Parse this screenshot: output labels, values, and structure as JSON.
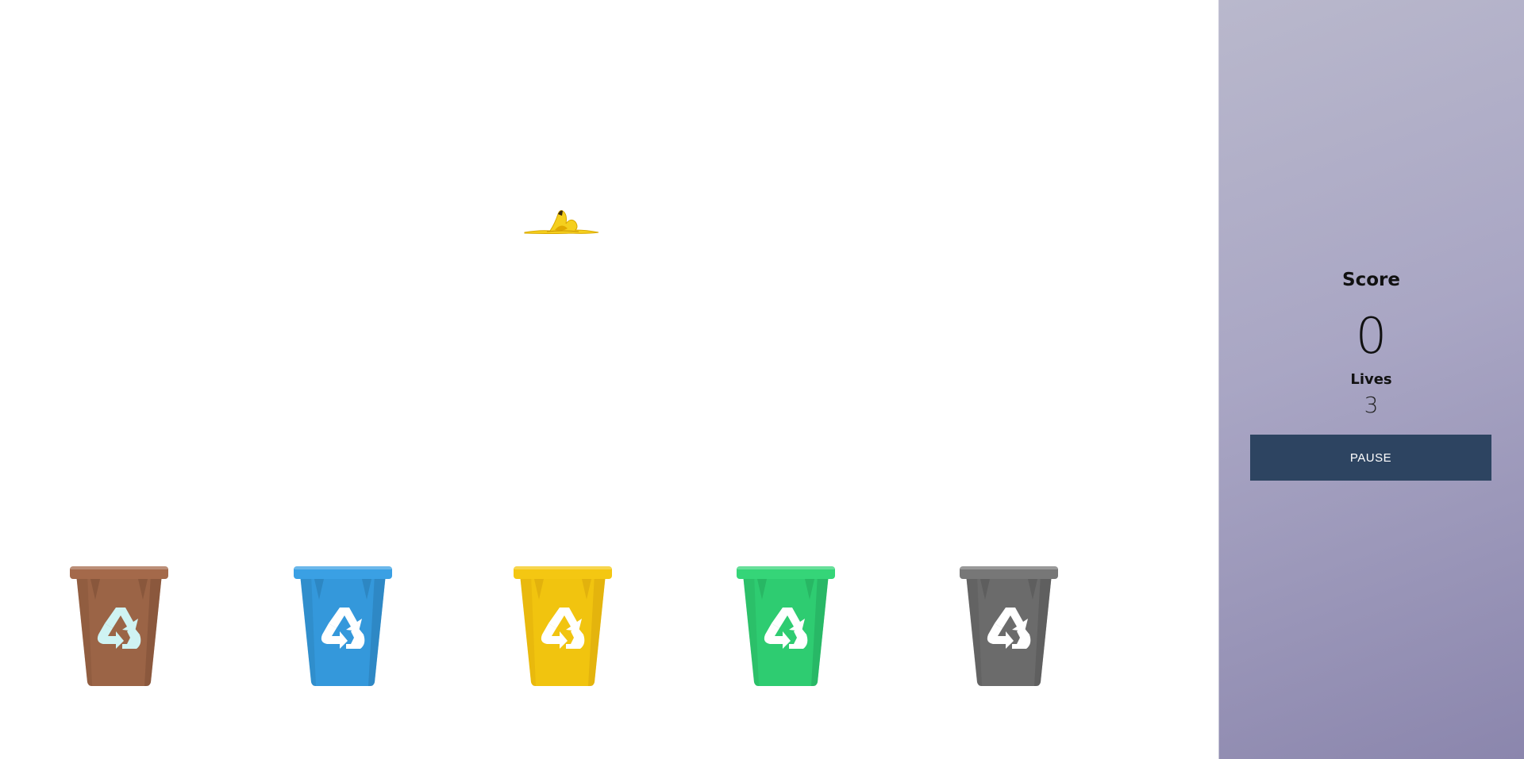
{
  "game": {
    "falling_item": {
      "name": "banana peel",
      "icon": "banana-peel-icon"
    },
    "bins": [
      {
        "name": "brown-bin",
        "color": "#9b6446",
        "dark": "#7d4f36",
        "lip": "#a4694a",
        "symbol": "#cff3f3"
      },
      {
        "name": "blue-bin",
        "color": "#3498db",
        "dark": "#2a7bb3",
        "lip": "#3aa0e4",
        "symbol": "#ffffff"
      },
      {
        "name": "yellow-bin",
        "color": "#f1c40f",
        "dark": "#d9a70c",
        "lip": "#f4c712",
        "symbol": "#ffffff"
      },
      {
        "name": "green-bin",
        "color": "#2ecc71",
        "dark": "#25a85c",
        "lip": "#35d578",
        "symbol": "#ffffff"
      },
      {
        "name": "gray-bin",
        "color": "#6b6b6b",
        "dark": "#555555",
        "lip": "#777777",
        "symbol": "#ffffff"
      }
    ]
  },
  "sidebar": {
    "score_label": "Score",
    "score_value": "0",
    "lives_label": "Lives",
    "lives_value": "3",
    "pause_label": "PAUSE",
    "pause_color": "#2d4461"
  }
}
